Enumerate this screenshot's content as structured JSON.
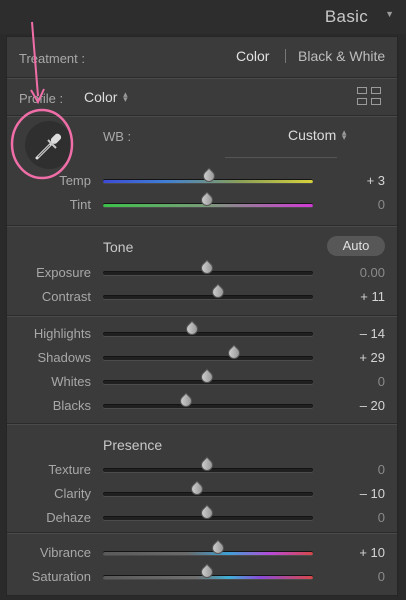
{
  "header": {
    "title": "Basic"
  },
  "treatment": {
    "label": "Treatment :",
    "option_color": "Color",
    "option_bw": "Black & White"
  },
  "profile": {
    "label": "Profile :",
    "value": "Color"
  },
  "wb": {
    "label": "WB :",
    "value": "Custom"
  },
  "sliders_wb": [
    {
      "label": "Temp",
      "value": "+ 3",
      "position": 0.51
    },
    {
      "label": "Tint",
      "value": "0",
      "position": 0.5
    }
  ],
  "tone": {
    "heading": "Tone",
    "auto_label": "Auto",
    "sliders": [
      {
        "label": "Exposure",
        "value": "0.00",
        "position": 0.5
      },
      {
        "label": "Contrast",
        "value": "+ 11",
        "position": 0.55
      }
    ],
    "sliders2": [
      {
        "label": "Highlights",
        "value": "– 14",
        "position": 0.43
      },
      {
        "label": "Shadows",
        "value": "+ 29",
        "position": 0.63
      },
      {
        "label": "Whites",
        "value": "0",
        "position": 0.5
      },
      {
        "label": "Blacks",
        "value": "– 20",
        "position": 0.4
      }
    ]
  },
  "presence": {
    "heading": "Presence",
    "sliders": [
      {
        "label": "Texture",
        "value": "0",
        "position": 0.5
      },
      {
        "label": "Clarity",
        "value": "– 10",
        "position": 0.45
      },
      {
        "label": "Dehaze",
        "value": "0",
        "position": 0.5
      }
    ],
    "sliders2": [
      {
        "label": "Vibrance",
        "value": "+ 10",
        "position": 0.55
      },
      {
        "label": "Saturation",
        "value": "0",
        "position": 0.5
      }
    ]
  },
  "annotation_color": "#f06ea8"
}
